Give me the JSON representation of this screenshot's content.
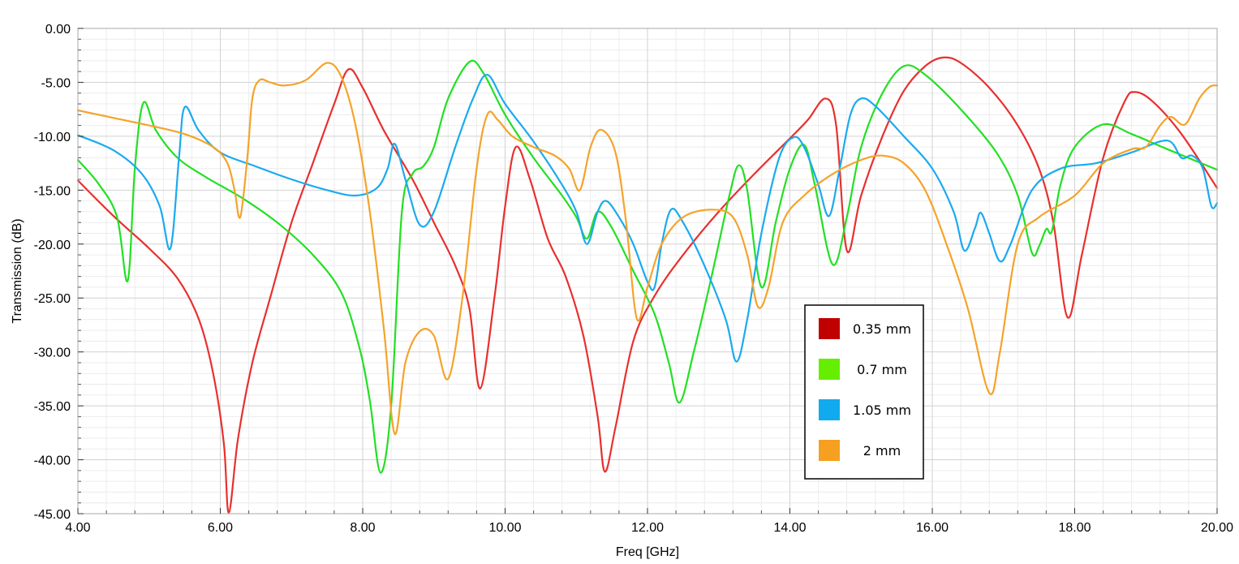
{
  "chart_data": {
    "type": "line",
    "title": "",
    "xlabel": "Freq [GHz]",
    "ylabel": "Transmission (dB)",
    "xlim": [
      4,
      20
    ],
    "ylim": [
      -45,
      0
    ],
    "x_ticks": [
      "4.00",
      "6.00",
      "8.00",
      "10.00",
      "12.00",
      "14.00",
      "16.00",
      "18.00",
      "20.00"
    ],
    "y_ticks": [
      "0.00",
      "-5.00",
      "-10.00",
      "-15.00",
      "-20.00",
      "-25.00",
      "-30.00",
      "-35.00",
      "-40.00",
      "-45.00"
    ],
    "grid": true,
    "legend_position": "bottom-right",
    "series": [
      {
        "name": "0.35 mm",
        "color": "#e8302e",
        "swatch": "#c00000",
        "points": [
          [
            4.0,
            -14.1
          ],
          [
            4.5,
            -17.4
          ],
          [
            5.0,
            -20.4
          ],
          [
            5.4,
            -23.2
          ],
          [
            5.7,
            -27.0
          ],
          [
            5.9,
            -32.0
          ],
          [
            6.05,
            -38.5
          ],
          [
            6.12,
            -44.9
          ],
          [
            6.25,
            -38.0
          ],
          [
            6.45,
            -31.0
          ],
          [
            6.7,
            -25.0
          ],
          [
            7.0,
            -18.0
          ],
          [
            7.3,
            -12.5
          ],
          [
            7.6,
            -7.0
          ],
          [
            7.8,
            -3.8
          ],
          [
            8.0,
            -5.5
          ],
          [
            8.3,
            -9.5
          ],
          [
            8.7,
            -14.0
          ],
          [
            9.0,
            -18.0
          ],
          [
            9.3,
            -22.0
          ],
          [
            9.5,
            -26.0
          ],
          [
            9.65,
            -33.4
          ],
          [
            9.85,
            -25.0
          ],
          [
            10.0,
            -16.5
          ],
          [
            10.15,
            -11.0
          ],
          [
            10.35,
            -14.0
          ],
          [
            10.6,
            -19.5
          ],
          [
            10.85,
            -23.0
          ],
          [
            11.1,
            -28.5
          ],
          [
            11.3,
            -36.0
          ],
          [
            11.4,
            -41.1
          ],
          [
            11.55,
            -37.0
          ],
          [
            11.8,
            -29.0
          ],
          [
            12.1,
            -24.8
          ],
          [
            12.5,
            -21.0
          ],
          [
            13.0,
            -17.0
          ],
          [
            13.5,
            -13.5
          ],
          [
            14.0,
            -10.2
          ],
          [
            14.25,
            -8.5
          ],
          [
            14.5,
            -6.5
          ],
          [
            14.65,
            -9.0
          ],
          [
            14.8,
            -20.6
          ],
          [
            15.0,
            -15.5
          ],
          [
            15.3,
            -10.0
          ],
          [
            15.6,
            -5.8
          ],
          [
            15.9,
            -3.5
          ],
          [
            16.15,
            -2.7
          ],
          [
            16.4,
            -3.2
          ],
          [
            16.8,
            -5.5
          ],
          [
            17.2,
            -9.0
          ],
          [
            17.5,
            -13.0
          ],
          [
            17.7,
            -18.0
          ],
          [
            17.9,
            -26.8
          ],
          [
            18.1,
            -21.0
          ],
          [
            18.4,
            -12.0
          ],
          [
            18.7,
            -6.8
          ],
          [
            18.85,
            -5.9
          ],
          [
            19.1,
            -6.8
          ],
          [
            19.5,
            -9.8
          ],
          [
            20.0,
            -14.8
          ]
        ]
      },
      {
        "name": "0.7 mm",
        "color": "#22e022",
        "swatch": "#66ee00",
        "points": [
          [
            4.0,
            -12.2
          ],
          [
            4.3,
            -14.5
          ],
          [
            4.55,
            -17.5
          ],
          [
            4.7,
            -23.4
          ],
          [
            4.8,
            -13.0
          ],
          [
            4.92,
            -6.9
          ],
          [
            5.1,
            -9.5
          ],
          [
            5.4,
            -12.0
          ],
          [
            5.8,
            -13.8
          ],
          [
            6.3,
            -15.7
          ],
          [
            6.8,
            -18.0
          ],
          [
            7.3,
            -21.0
          ],
          [
            7.7,
            -24.5
          ],
          [
            7.95,
            -29.5
          ],
          [
            8.1,
            -34.5
          ],
          [
            8.25,
            -41.2
          ],
          [
            8.4,
            -35.0
          ],
          [
            8.55,
            -17.0
          ],
          [
            8.7,
            -13.5
          ],
          [
            8.85,
            -12.8
          ],
          [
            9.0,
            -11.0
          ],
          [
            9.2,
            -6.5
          ],
          [
            9.5,
            -3.1
          ],
          [
            9.7,
            -4.2
          ],
          [
            10.0,
            -8.0
          ],
          [
            10.4,
            -12.0
          ],
          [
            10.8,
            -15.5
          ],
          [
            11.0,
            -17.5
          ],
          [
            11.15,
            -19.5
          ],
          [
            11.3,
            -17.0
          ],
          [
            11.5,
            -18.5
          ],
          [
            11.8,
            -22.5
          ],
          [
            12.1,
            -26.5
          ],
          [
            12.3,
            -31.0
          ],
          [
            12.45,
            -34.7
          ],
          [
            12.65,
            -30.0
          ],
          [
            12.9,
            -23.0
          ],
          [
            13.15,
            -15.5
          ],
          [
            13.28,
            -12.7
          ],
          [
            13.4,
            -15.0
          ],
          [
            13.6,
            -24.0
          ],
          [
            13.8,
            -18.0
          ],
          [
            14.0,
            -13.0
          ],
          [
            14.2,
            -10.8
          ],
          [
            14.35,
            -14.5
          ],
          [
            14.6,
            -21.9
          ],
          [
            14.8,
            -17.5
          ],
          [
            15.0,
            -11.0
          ],
          [
            15.3,
            -6.0
          ],
          [
            15.6,
            -3.5
          ],
          [
            15.9,
            -4.3
          ],
          [
            16.4,
            -7.5
          ],
          [
            16.9,
            -11.5
          ],
          [
            17.2,
            -15.5
          ],
          [
            17.4,
            -20.8
          ],
          [
            17.5,
            -20.2
          ],
          [
            17.6,
            -18.6
          ],
          [
            17.68,
            -18.8
          ],
          [
            17.8,
            -14.5
          ],
          [
            18.0,
            -11.0
          ],
          [
            18.4,
            -8.9
          ],
          [
            18.8,
            -9.8
          ],
          [
            19.3,
            -11.2
          ],
          [
            20.0,
            -13.1
          ]
        ]
      },
      {
        "name": "1.05 mm",
        "color": "#1aaaf0",
        "swatch": "#11aaee",
        "points": [
          [
            4.0,
            -9.9
          ],
          [
            4.5,
            -11.3
          ],
          [
            4.9,
            -13.5
          ],
          [
            5.15,
            -16.5
          ],
          [
            5.3,
            -20.4
          ],
          [
            5.42,
            -12.0
          ],
          [
            5.5,
            -7.3
          ],
          [
            5.7,
            -9.5
          ],
          [
            6.0,
            -11.5
          ],
          [
            6.5,
            -12.8
          ],
          [
            7.0,
            -14.0
          ],
          [
            7.5,
            -15.0
          ],
          [
            7.9,
            -15.5
          ],
          [
            8.2,
            -14.8
          ],
          [
            8.35,
            -13.0
          ],
          [
            8.45,
            -10.7
          ],
          [
            8.6,
            -14.0
          ],
          [
            8.8,
            -18.2
          ],
          [
            9.0,
            -17.0
          ],
          [
            9.3,
            -11.0
          ],
          [
            9.55,
            -6.5
          ],
          [
            9.75,
            -4.3
          ],
          [
            10.0,
            -7.0
          ],
          [
            10.4,
            -10.5
          ],
          [
            10.8,
            -14.5
          ],
          [
            11.0,
            -17.0
          ],
          [
            11.15,
            -20.0
          ],
          [
            11.3,
            -17.0
          ],
          [
            11.42,
            -16.0
          ],
          [
            11.6,
            -17.5
          ],
          [
            11.8,
            -20.0
          ],
          [
            12.0,
            -23.5
          ],
          [
            12.1,
            -24.0
          ],
          [
            12.2,
            -20.0
          ],
          [
            12.33,
            -16.8
          ],
          [
            12.5,
            -18.0
          ],
          [
            12.8,
            -22.0
          ],
          [
            13.1,
            -27.0
          ],
          [
            13.25,
            -30.9
          ],
          [
            13.4,
            -27.0
          ],
          [
            13.6,
            -19.0
          ],
          [
            13.85,
            -12.0
          ],
          [
            14.05,
            -10.1
          ],
          [
            14.2,
            -11.0
          ],
          [
            14.4,
            -14.5
          ],
          [
            14.55,
            -17.4
          ],
          [
            14.7,
            -13.0
          ],
          [
            14.85,
            -8.0
          ],
          [
            15.0,
            -6.5
          ],
          [
            15.2,
            -7.2
          ],
          [
            15.6,
            -10.0
          ],
          [
            16.0,
            -13.0
          ],
          [
            16.3,
            -17.0
          ],
          [
            16.45,
            -20.6
          ],
          [
            16.6,
            -18.5
          ],
          [
            16.68,
            -17.1
          ],
          [
            16.8,
            -19.0
          ],
          [
            16.95,
            -21.6
          ],
          [
            17.1,
            -20.0
          ],
          [
            17.4,
            -15.0
          ],
          [
            17.8,
            -13.0
          ],
          [
            18.3,
            -12.5
          ],
          [
            18.8,
            -11.5
          ],
          [
            19.3,
            -10.4
          ],
          [
            19.5,
            -12.0
          ],
          [
            19.65,
            -11.8
          ],
          [
            19.8,
            -13.0
          ],
          [
            19.92,
            -16.5
          ],
          [
            20.0,
            -16.2
          ]
        ]
      },
      {
        "name": "2 mm",
        "color": "#f5a32a",
        "swatch": "#f5a020",
        "points": [
          [
            4.0,
            -7.6
          ],
          [
            4.5,
            -8.3
          ],
          [
            5.0,
            -9.0
          ],
          [
            5.5,
            -9.8
          ],
          [
            5.9,
            -11.0
          ],
          [
            6.1,
            -12.5
          ],
          [
            6.2,
            -15.0
          ],
          [
            6.28,
            -17.5
          ],
          [
            6.38,
            -12.0
          ],
          [
            6.45,
            -6.5
          ],
          [
            6.55,
            -4.8
          ],
          [
            6.7,
            -5.0
          ],
          [
            6.9,
            -5.3
          ],
          [
            7.2,
            -4.8
          ],
          [
            7.5,
            -3.2
          ],
          [
            7.7,
            -4.5
          ],
          [
            7.9,
            -9.0
          ],
          [
            8.1,
            -17.0
          ],
          [
            8.3,
            -28.0
          ],
          [
            8.45,
            -37.6
          ],
          [
            8.6,
            -31.0
          ],
          [
            8.8,
            -28.1
          ],
          [
            9.0,
            -28.5
          ],
          [
            9.2,
            -32.5
          ],
          [
            9.4,
            -25.0
          ],
          [
            9.6,
            -13.0
          ],
          [
            9.75,
            -8.0
          ],
          [
            9.9,
            -8.5
          ],
          [
            10.1,
            -10.0
          ],
          [
            10.4,
            -11.0
          ],
          [
            10.7,
            -11.8
          ],
          [
            10.9,
            -13.0
          ],
          [
            11.05,
            -15.0
          ],
          [
            11.2,
            -11.0
          ],
          [
            11.35,
            -9.4
          ],
          [
            11.55,
            -11.5
          ],
          [
            11.7,
            -18.0
          ],
          [
            11.85,
            -26.9
          ],
          [
            12.0,
            -24.0
          ],
          [
            12.2,
            -20.0
          ],
          [
            12.5,
            -17.5
          ],
          [
            12.9,
            -16.8
          ],
          [
            13.2,
            -17.5
          ],
          [
            13.4,
            -21.0
          ],
          [
            13.55,
            -25.8
          ],
          [
            13.7,
            -24.0
          ],
          [
            13.9,
            -18.0
          ],
          [
            14.2,
            -15.5
          ],
          [
            14.6,
            -13.5
          ],
          [
            15.0,
            -12.2
          ],
          [
            15.3,
            -11.8
          ],
          [
            15.6,
            -12.5
          ],
          [
            15.9,
            -15.0
          ],
          [
            16.2,
            -20.0
          ],
          [
            16.5,
            -26.0
          ],
          [
            16.8,
            -33.8
          ],
          [
            16.95,
            -30.0
          ],
          [
            17.2,
            -20.0
          ],
          [
            17.5,
            -17.5
          ],
          [
            18.0,
            -15.5
          ],
          [
            18.4,
            -12.5
          ],
          [
            18.8,
            -11.2
          ],
          [
            19.0,
            -11.0
          ],
          [
            19.2,
            -9.0
          ],
          [
            19.35,
            -8.2
          ],
          [
            19.55,
            -8.9
          ],
          [
            19.75,
            -6.5
          ],
          [
            19.9,
            -5.4
          ],
          [
            20.0,
            -5.3
          ]
        ]
      }
    ]
  }
}
